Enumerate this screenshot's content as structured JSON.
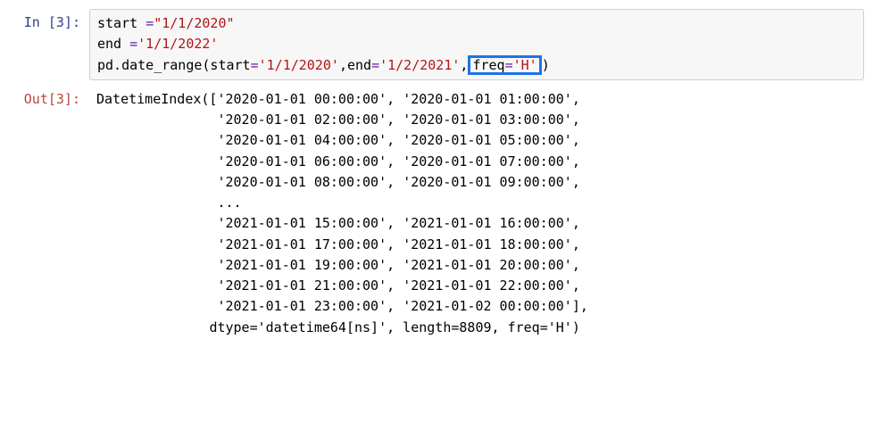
{
  "cell_number": 3,
  "prompt_in": "In [3]:",
  "prompt_out": "Out[3]:",
  "code": {
    "v_start": "start ",
    "v_end": "end ",
    "eq": "=",
    "str_start": "\"1/1/2020\"",
    "str_end": "'1/1/2022'",
    "pd_call_a": "pd.date_range(start",
    "pd_call_b": ",end",
    "pd_call_c": ",",
    "pd_call_d": ")",
    "arg_start": "'1/1/2020'",
    "arg_end": "'1/2/2021'",
    "hl_key": "freq",
    "hl_val": "'H'"
  },
  "output": {
    "head": "DatetimeIndex([",
    "head_rows": [
      [
        "'2020-01-01 00:00:00'",
        "'2020-01-01 01:00:00'"
      ],
      [
        "'2020-01-01 02:00:00'",
        "'2020-01-01 03:00:00'"
      ],
      [
        "'2020-01-01 04:00:00'",
        "'2020-01-01 05:00:00'"
      ],
      [
        "'2020-01-01 06:00:00'",
        "'2020-01-01 07:00:00'"
      ],
      [
        "'2020-01-01 08:00:00'",
        "'2020-01-01 09:00:00'"
      ]
    ],
    "ellipsis": "...",
    "tail_rows": [
      [
        "'2021-01-01 15:00:00'",
        "'2021-01-01 16:00:00'"
      ],
      [
        "'2021-01-01 17:00:00'",
        "'2021-01-01 18:00:00'"
      ],
      [
        "'2021-01-01 19:00:00'",
        "'2021-01-01 20:00:00'"
      ],
      [
        "'2021-01-01 21:00:00'",
        "'2021-01-01 22:00:00'"
      ],
      [
        "'2021-01-01 23:00:00'",
        "'2021-01-02 00:00:00'"
      ]
    ],
    "dtype_line": "dtype='datetime64[ns]', length=8809, freq='H')"
  }
}
